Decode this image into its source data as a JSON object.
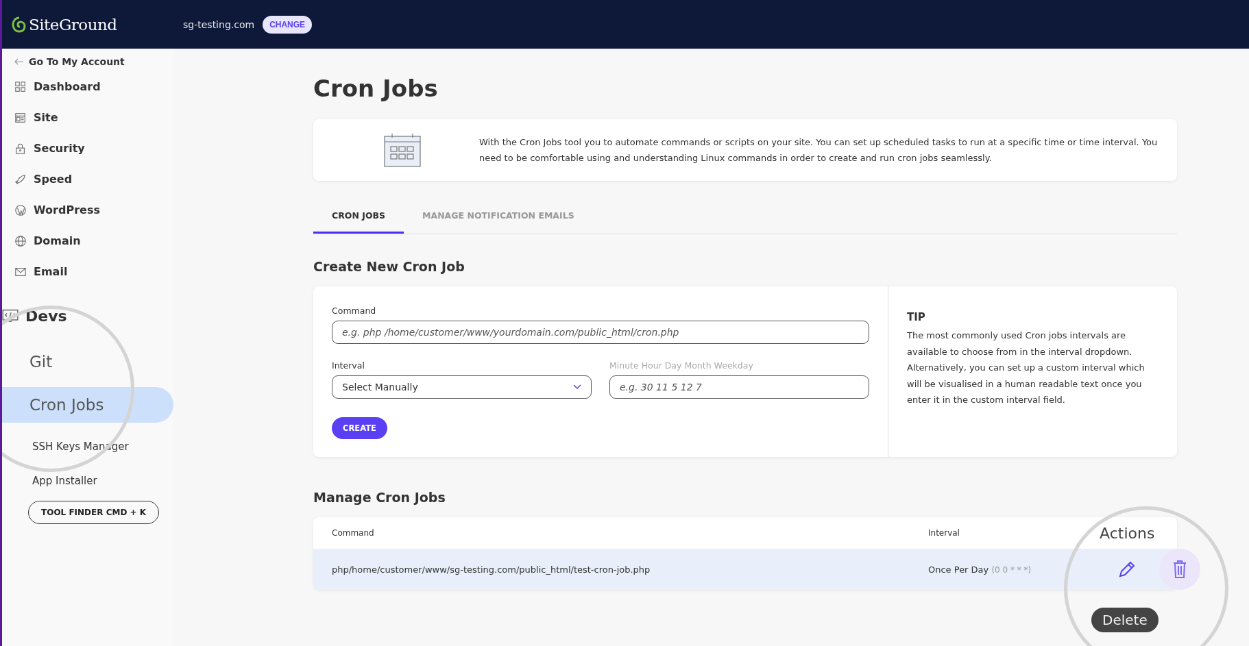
{
  "header": {
    "logo": "SiteGround",
    "site": "sg-testing.com",
    "change_button": "CHANGE"
  },
  "sidebar": {
    "back_link": "Go To My Account",
    "items": [
      {
        "label": "Dashboard"
      },
      {
        "label": "Site"
      },
      {
        "label": "Security"
      },
      {
        "label": "Speed"
      },
      {
        "label": "WordPress"
      },
      {
        "label": "Domain"
      },
      {
        "label": "Email"
      },
      {
        "label": "Devs",
        "magnified": true,
        "children": [
          {
            "label": "Git",
            "selected": false,
            "magnified": true
          },
          {
            "label": "Cron Jobs",
            "selected": true,
            "magnified": true
          },
          {
            "label": "SSH Keys Manager",
            "selected": false,
            "magnified": false
          },
          {
            "label": "App Installer",
            "selected": false,
            "magnified": false
          }
        ]
      }
    ],
    "tool_finder_button": "TOOL FINDER CMD + K"
  },
  "page": {
    "title": "Cron Jobs",
    "intro": "With the Cron Jobs tool you to automate commands or scripts on your site. You can set up scheduled tasks to run at a specific time or time interval. You need to be comfortable using and understanding Linux commands in order to create and run cron jobs seamlessly.",
    "tabs": [
      {
        "label": "CRON JOBS",
        "selected": true
      },
      {
        "label": "MANAGE NOTIFICATION EMAILS",
        "selected": false
      }
    ],
    "create": {
      "heading": "Create New Cron Job",
      "command_label": "Command",
      "command_placeholder": "e.g. php /home/customer/www/yourdomain.com/public_html/cron.php",
      "interval_label": "Interval",
      "interval_value": "Select Manually",
      "custom_label": "Minute Hour Day Month Weekday",
      "custom_placeholder": "e.g. 30 11 5 12 7",
      "create_button": "CREATE",
      "tip_title": "TIP",
      "tip_text": "The most commonly used Cron jobs intervals are available to choose from in the interval dropdown. Alternatively, you can set up a custom interval which will be visualised in a human readable text once you enter it in the custom interval field."
    },
    "manage": {
      "heading": "Manage Cron Jobs",
      "columns": [
        "Command",
        "Interval",
        "Actions"
      ],
      "rows": [
        {
          "command": "php/home/customer/www/sg-testing.com/public_html/test-cron-job.php",
          "interval": "Once Per Day",
          "expression": "(0 0 * * *)"
        }
      ],
      "tooltip": "Delete"
    }
  }
}
